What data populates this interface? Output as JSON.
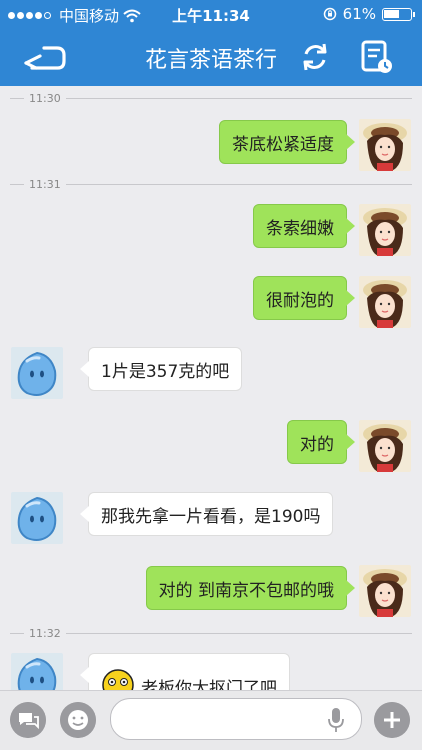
{
  "status_bar": {
    "carrier": "中国移动",
    "time": "上午11:34",
    "battery": "61%",
    "battery_level": 0.61
  },
  "nav": {
    "title": "花言茶语茶行",
    "icons": [
      "back-icon",
      "refresh-icon",
      "contact-info-icon"
    ]
  },
  "chat": {
    "timestamps": [
      "11:30",
      "11:31",
      "11:32"
    ],
    "messages": [
      {
        "side": "out",
        "text": "茶底松紧适度"
      },
      {
        "side": "out",
        "text": "条索细嫩"
      },
      {
        "side": "out",
        "text": "很耐泡的"
      },
      {
        "side": "in",
        "text": "1片是357克的吧"
      },
      {
        "side": "out",
        "text": "对的"
      },
      {
        "side": "in",
        "text": "那我先拿一片看看，是190吗"
      },
      {
        "side": "out",
        "text": "对的 到南京不包邮的哦"
      },
      {
        "side": "in",
        "text": "老板你太抠门了吧"
      }
    ]
  },
  "input_bar": {
    "placeholder": "",
    "icons": [
      "chat-menu-icon",
      "emoji-icon",
      "microphone-icon",
      "plus-icon"
    ]
  },
  "colors": {
    "brand_blue": "#2f86d4",
    "outgoing_bubble": "#9fe35a",
    "incoming_bubble": "#ffffff",
    "background": "#ececef"
  }
}
